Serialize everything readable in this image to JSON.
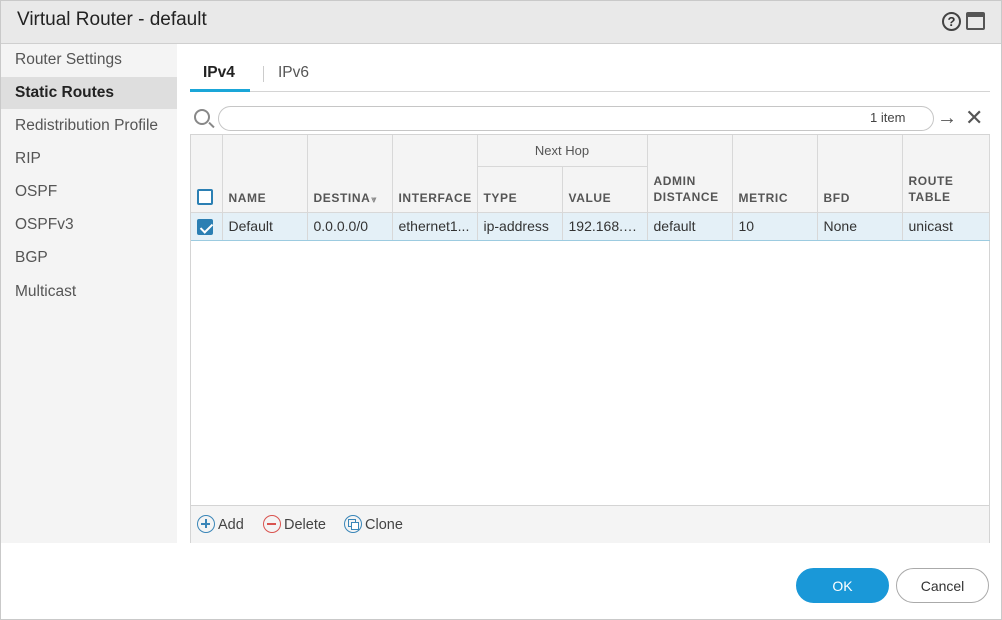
{
  "window": {
    "title": "Virtual Router - default"
  },
  "sidebar": {
    "items": [
      {
        "label": "Router Settings",
        "active": false
      },
      {
        "label": "Static Routes",
        "active": true
      },
      {
        "label": "Redistribution Profile",
        "active": false
      },
      {
        "label": "RIP",
        "active": false
      },
      {
        "label": "OSPF",
        "active": false
      },
      {
        "label": "OSPFv3",
        "active": false
      },
      {
        "label": "BGP",
        "active": false
      },
      {
        "label": "Multicast",
        "active": false
      }
    ]
  },
  "tabs": [
    {
      "label": "IPv4",
      "active": true
    },
    {
      "label": "IPv6",
      "active": false
    }
  ],
  "search": {
    "value": "",
    "placeholder": "",
    "count": "1 item"
  },
  "table": {
    "group_header": "Next Hop",
    "columns": {
      "name": "NAME",
      "destination": "DESTINA",
      "interface": "INTERFACE",
      "type": "TYPE",
      "value": "VALUE",
      "admin_distance": "ADMIN DISTANCE",
      "metric": "METRIC",
      "bfd": "BFD",
      "route_table": "ROUTE TABLE"
    },
    "rows": [
      {
        "checked": true,
        "name": "Default",
        "destination": "0.0.0.0/0",
        "interface": "ethernet1...",
        "type": "ip-address",
        "value": "192.168.1...",
        "admin_distance": "default",
        "metric": "10",
        "bfd": "None",
        "route_table": "unicast"
      }
    ]
  },
  "actions": {
    "add": "Add",
    "delete": "Delete",
    "clone": "Clone"
  },
  "buttons": {
    "ok": "OK",
    "cancel": "Cancel"
  },
  "colors": {
    "accent": "#1a98d8",
    "selected_row": "#e4f0f7",
    "delete": "#d9534f"
  }
}
